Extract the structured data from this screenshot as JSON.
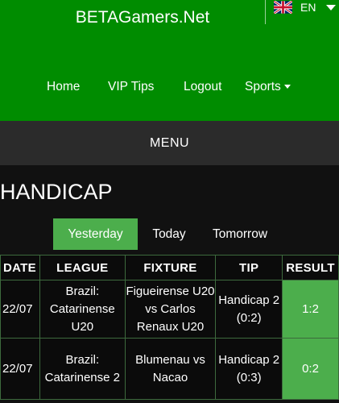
{
  "header": {
    "site_title": "BETAGamers.Net",
    "language": {
      "code": "EN",
      "flag_icon": "uk-flag-icon"
    },
    "nav": [
      {
        "label": "Home"
      },
      {
        "label": "VIP Tips"
      },
      {
        "label": "Logout"
      },
      {
        "label": "Sports"
      }
    ]
  },
  "menu": {
    "label": "MENU"
  },
  "section": {
    "title": "HANDICAP",
    "tabs": [
      {
        "label": "Yesterday",
        "active": true
      },
      {
        "label": "Today",
        "active": false
      },
      {
        "label": "Tomorrow",
        "active": false
      }
    ]
  },
  "table": {
    "columns": [
      "DATE",
      "LEAGUE",
      "FIXTURE",
      "TIP",
      "RESULT"
    ],
    "rows": [
      {
        "date": "22/07",
        "league": "Brazil: Catarinense U20",
        "fixture": "Figueirense U20 vs Carlos Renaux U20",
        "tip": "Handicap 2 (0:2)",
        "result": "1:2"
      },
      {
        "date": "22/07",
        "league": "Brazil: Catarinense 2",
        "fixture": "Blumenau vs Nacao",
        "tip": "Handicap 2 (0:3)",
        "result": "0:2"
      }
    ]
  },
  "colors": {
    "header_green": "#008c00",
    "accent_green": "#4cae4c",
    "menu_bar": "#2b2b2b",
    "background": "#111111"
  }
}
